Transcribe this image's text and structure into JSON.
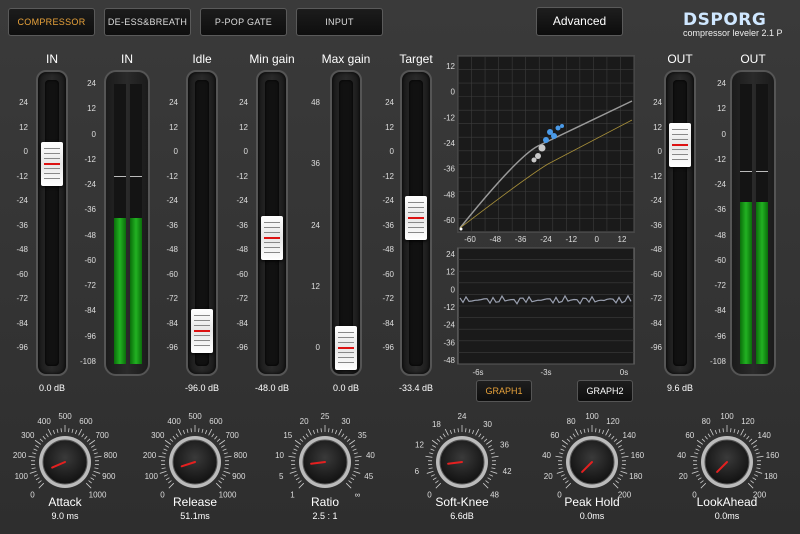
{
  "tabs": [
    {
      "label": "COMPRESSOR",
      "active": true
    },
    {
      "label": "DE-ESS&BREATH",
      "active": false
    },
    {
      "label": "P-POP  GATE",
      "active": false
    },
    {
      "label": "INPUT",
      "active": false
    }
  ],
  "advanced_label": "Advanced",
  "logo": {
    "text": "DSPORG",
    "subtitle": "compressor leveler 2.1 P"
  },
  "sliders": [
    {
      "label": "IN",
      "value_text": "0.0 dB",
      "ticks": [
        "24",
        "12",
        "0",
        "-12",
        "-24",
        "-36",
        "-48",
        "-60",
        "-72",
        "-84",
        "-96"
      ],
      "level": 0.25
    },
    {
      "label": "Idle",
      "value_text": "-96.0 dB",
      "ticks": [
        "24",
        "12",
        "0",
        "-12",
        "-24",
        "-36",
        "-48",
        "-60",
        "-72",
        "-84",
        "-96"
      ],
      "level": 0.93
    },
    {
      "label": "Min gain",
      "value_text": "-48.0 dB",
      "ticks": [
        "24",
        "12",
        "0",
        "-12",
        "-24",
        "-36",
        "-48",
        "-60",
        "-72",
        "-84",
        "-96"
      ],
      "level": 0.55
    },
    {
      "label": "Max gain",
      "value_text": "0.0 dB",
      "ticks": [
        "48",
        "36",
        "24",
        "12",
        "0"
      ],
      "level": 1.0
    },
    {
      "label": "Target",
      "value_text": "-33.4 dB",
      "ticks": [
        "24",
        "12",
        "0",
        "-12",
        "-24",
        "-36",
        "-48",
        "-60",
        "-72",
        "-84",
        "-96"
      ],
      "level": 0.47
    },
    {
      "label": "OUT",
      "value_text": "9.6 dB",
      "ticks": [
        "24",
        "12",
        "0",
        "-12",
        "-24",
        "-36",
        "-48",
        "-60",
        "-72",
        "-84",
        "-96"
      ],
      "level": 0.17
    }
  ],
  "meters": [
    {
      "label": "IN",
      "ticks": [
        "24",
        "12",
        "0",
        "-12",
        "-24",
        "-36",
        "-48",
        "-60",
        "-72",
        "-84",
        "-96",
        "-108"
      ],
      "fill_level": 0.52,
      "peak_level": 0.67
    },
    {
      "label": "OUT",
      "ticks": [
        "24",
        "12",
        "0",
        "-12",
        "-24",
        "-36",
        "-48",
        "-60",
        "-72",
        "-84",
        "-96",
        "-108"
      ],
      "fill_level": 0.58,
      "peak_level": 0.69
    }
  ],
  "graph_top": {
    "y_ticks": [
      "12",
      "0",
      "-12",
      "-24",
      "-36",
      "-48",
      "-60"
    ],
    "x_ticks": [
      "-60",
      "-48",
      "-36",
      "-24",
      "-12",
      "0",
      "12"
    ]
  },
  "graph_bottom": {
    "y_ticks": [
      "24",
      "12",
      "0",
      "-12",
      "-24",
      "-36",
      "-48"
    ],
    "x_ticks": [
      "-6s",
      "-3s",
      "0s"
    ]
  },
  "graph_buttons": [
    {
      "label": "GRAPH1",
      "active": true
    },
    {
      "label": "GRAPH2",
      "active": false
    }
  ],
  "knobs": [
    {
      "label": "Attack",
      "value_text": "9.0 ms",
      "scale": [
        "0",
        "100",
        "200",
        "300",
        "400",
        "500",
        "600",
        "700",
        "800",
        "900",
        "1000"
      ],
      "fraction": 0.08
    },
    {
      "label": "Release",
      "value_text": "51.1ms",
      "scale": [
        "0",
        "100",
        "200",
        "300",
        "400",
        "500",
        "600",
        "700",
        "800",
        "900",
        "1000"
      ],
      "fraction": 0.1
    },
    {
      "label": "Ratio",
      "value_text": "2.5 : 1",
      "scale": [
        "1",
        "5",
        "10",
        "15",
        "20",
        "25",
        "30",
        "35",
        "40",
        "45",
        "∞"
      ],
      "fraction": 0.14
    },
    {
      "label": "Soft-Knee",
      "value_text": "6.6dB",
      "scale": [
        "0",
        "6",
        "12",
        "18",
        "24",
        "30",
        "36",
        "42",
        "48"
      ],
      "fraction": 0.14
    },
    {
      "label": "Peak Hold",
      "value_text": "0.0ms",
      "scale": [
        "0",
        "20",
        "40",
        "60",
        "80",
        "100",
        "120",
        "140",
        "160",
        "180",
        "200"
      ],
      "fraction": 0.0
    },
    {
      "label": "LookAhead",
      "value_text": "0.0ms",
      "scale": [
        "0",
        "20",
        "40",
        "60",
        "80",
        "100",
        "120",
        "140",
        "160",
        "180",
        "200"
      ],
      "fraction": 0.0
    }
  ],
  "colors": {
    "accent": "#e8a23a",
    "meter_green": "#22b222",
    "graph_bg": "#1a1a1a"
  }
}
